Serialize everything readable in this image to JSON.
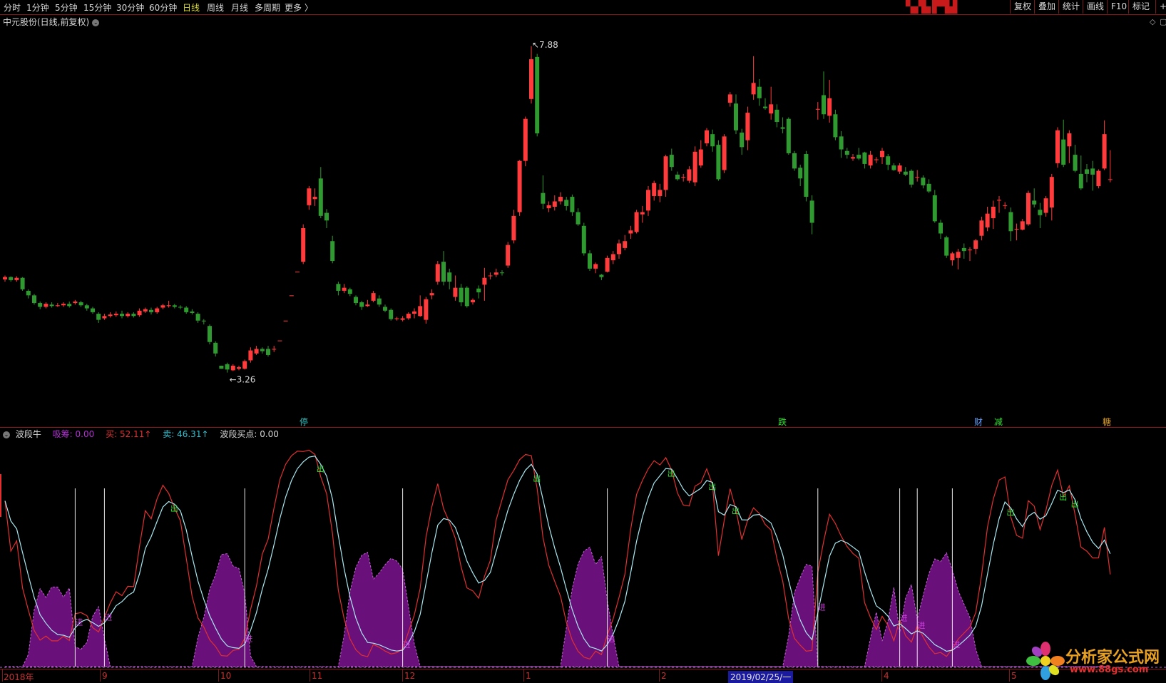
{
  "toolbar": {
    "periods": [
      "分时",
      "1分钟",
      "5分钟",
      "15分钟",
      "30分钟",
      "60分钟",
      "日线",
      "周线",
      "月线",
      "多周期",
      "更多 〉"
    ],
    "active_period": "日线",
    "tools": [
      "复权",
      "叠加",
      "统计",
      "画线",
      "F10",
      "标记",
      "+"
    ]
  },
  "stock": {
    "title": "中元股份(日线,前复权)",
    "high_label": "7.88",
    "low_label": "3.26"
  },
  "price_markers": [
    {
      "text": "停",
      "color": "#30c0c0"
    },
    {
      "text": "跌",
      "color": "#30e030"
    },
    {
      "text": "财",
      "color": "#60a0ff"
    },
    {
      "text": "减",
      "color": "#30e030"
    },
    {
      "text": "糖",
      "color": "#e0a020"
    }
  ],
  "indicator": {
    "name": "波段牛",
    "items": [
      {
        "label": "吸筹:",
        "value": "0.00",
        "color": "#b030d0"
      },
      {
        "label": "买:",
        "value": "52.11↑",
        "color": "#e03030"
      },
      {
        "label": "卖:",
        "value": "46.31↑",
        "color": "#30c0d0"
      },
      {
        "label": "波段买点:",
        "value": "0.00",
        "color": "#d8d8d8"
      }
    ],
    "signal_out": "出",
    "signal_in": "进"
  },
  "x_axis": [
    "2018年",
    "9",
    "10",
    "11",
    "12",
    "1",
    "2",
    "2019/02/25/一",
    "4",
    "5"
  ],
  "watermark": {
    "cn": "分析家公式网",
    "url": "www.88gs.com"
  },
  "colors": {
    "up": "#ff3b3b",
    "down": "#2f9a2f",
    "buy_line": "#e03030",
    "sell_line": "#a8e8f0",
    "accum": "#6a107a"
  },
  "chart_data": {
    "type": "candlestick",
    "title": "中元股份(日线,前复权)",
    "price_range": [
      3.0,
      8.0
    ],
    "max_price": 7.88,
    "min_price": 3.26,
    "candles": [
      [
        4.83,
        4.86,
        4.88,
        4.8
      ],
      [
        4.86,
        4.82,
        4.87,
        4.8
      ],
      [
        4.82,
        4.85,
        4.87,
        4.8
      ],
      [
        4.85,
        4.7,
        4.86,
        4.68
      ],
      [
        4.68,
        4.62,
        4.7,
        4.58
      ],
      [
        4.62,
        4.52,
        4.64,
        4.5
      ],
      [
        4.52,
        4.47,
        4.54,
        4.44
      ],
      [
        4.47,
        4.51,
        4.53,
        4.45
      ],
      [
        4.5,
        4.48,
        4.53,
        4.46
      ],
      [
        4.48,
        4.49,
        4.52,
        4.47
      ],
      [
        4.49,
        4.51,
        4.53,
        4.47
      ],
      [
        4.51,
        4.48,
        4.54,
        4.46
      ],
      [
        4.52,
        4.54,
        4.56,
        4.5
      ],
      [
        4.53,
        4.49,
        4.55,
        4.47
      ],
      [
        4.49,
        4.45,
        4.51,
        4.42
      ],
      [
        4.45,
        4.4,
        4.47,
        4.38
      ],
      [
        4.38,
        4.3,
        4.4,
        4.26
      ],
      [
        4.32,
        4.35,
        4.38,
        4.3
      ],
      [
        4.35,
        4.37,
        4.4,
        4.33
      ],
      [
        4.36,
        4.38,
        4.41,
        4.34
      ],
      [
        4.38,
        4.35,
        4.42,
        4.32
      ],
      [
        4.35,
        4.38,
        4.4,
        4.33
      ],
      [
        4.38,
        4.35,
        4.4,
        4.33
      ],
      [
        4.36,
        4.42,
        4.45,
        4.34
      ],
      [
        4.41,
        4.44,
        4.46,
        4.39
      ],
      [
        4.43,
        4.4,
        4.46,
        4.37
      ],
      [
        4.4,
        4.45,
        4.47,
        4.38
      ],
      [
        4.46,
        4.49,
        4.51,
        4.44
      ],
      [
        4.48,
        4.49,
        4.55,
        4.46
      ],
      [
        4.49,
        4.47,
        4.51,
        4.45
      ],
      [
        4.47,
        4.46,
        4.49,
        4.44
      ],
      [
        4.46,
        4.4,
        4.48,
        4.38
      ],
      [
        4.41,
        4.39,
        4.44,
        4.37
      ],
      [
        4.38,
        4.29,
        4.4,
        4.26
      ],
      [
        4.29,
        4.28,
        4.31,
        4.24
      ],
      [
        4.22,
        4.01,
        4.24,
        3.98
      ],
      [
        4.0,
        3.86,
        4.02,
        3.82
      ],
      [
        3.7,
        3.66,
        3.7,
        3.66
      ],
      [
        3.72,
        3.65,
        3.74,
        3.61
      ],
      [
        3.64,
        3.7,
        3.72,
        3.63
      ],
      [
        3.66,
        3.68,
        3.7,
        3.64
      ],
      [
        3.66,
        3.76,
        3.78,
        3.65
      ],
      [
        3.77,
        3.9,
        3.94,
        3.74
      ],
      [
        3.86,
        3.92,
        3.96,
        3.84
      ],
      [
        3.92,
        3.89,
        3.94,
        3.86
      ],
      [
        3.92,
        3.84,
        3.96,
        3.82
      ],
      [
        3.91,
        3.92,
        3.96,
        3.88
      ],
      [
        4.03,
        4.03,
        4.03,
        4.03
      ],
      [
        4.29,
        4.29,
        4.29,
        4.29
      ],
      [
        4.62,
        4.62,
        4.62,
        4.62
      ],
      [
        4.93,
        4.93,
        4.93,
        4.93
      ],
      [
        5.06,
        5.5,
        5.55,
        5.03
      ],
      [
        5.8,
        6.02,
        6.05,
        5.74
      ],
      [
        5.88,
        5.91,
        6.02,
        5.79
      ],
      [
        6.15,
        5.66,
        6.3,
        5.63
      ],
      [
        5.7,
        5.6,
        5.75,
        5.5
      ],
      [
        5.33,
        5.07,
        5.4,
        5.04
      ],
      [
        4.77,
        4.68,
        4.8,
        4.62
      ],
      [
        4.68,
        4.72,
        4.77,
        4.65
      ],
      [
        4.7,
        4.64,
        4.72,
        4.61
      ],
      [
        4.6,
        4.52,
        4.62,
        4.49
      ],
      [
        4.53,
        4.47,
        4.55,
        4.43
      ],
      [
        4.48,
        4.5,
        4.56,
        4.47
      ],
      [
        4.55,
        4.65,
        4.68,
        4.53
      ],
      [
        4.58,
        4.5,
        4.62,
        4.47
      ],
      [
        4.47,
        4.42,
        4.5,
        4.4
      ],
      [
        4.43,
        4.31,
        4.45,
        4.29
      ],
      [
        4.31,
        4.32,
        4.34,
        4.29
      ],
      [
        4.3,
        4.32,
        4.35,
        4.28
      ],
      [
        4.32,
        4.38,
        4.4,
        4.3
      ],
      [
        4.38,
        4.41,
        4.45,
        4.32
      ],
      [
        4.35,
        4.48,
        4.62,
        4.34
      ],
      [
        4.3,
        4.57,
        4.6,
        4.25
      ],
      [
        4.62,
        4.65,
        4.7,
        4.57
      ],
      [
        4.8,
        5.03,
        5.07,
        4.76
      ],
      [
        5.06,
        4.8,
        5.2,
        4.75
      ],
      [
        4.92,
        4.8,
        4.97,
        4.7
      ],
      [
        4.6,
        4.72,
        4.88,
        4.55
      ],
      [
        4.72,
        4.53,
        4.77,
        4.48
      ],
      [
        4.72,
        4.48,
        4.74,
        4.46
      ],
      [
        4.53,
        4.56,
        4.58,
        4.5
      ],
      [
        4.71,
        4.66,
        4.75,
        4.58
      ],
      [
        4.76,
        4.85,
        4.98,
        4.55
      ],
      [
        4.88,
        4.88,
        4.92,
        4.83
      ],
      [
        4.89,
        4.92,
        4.97,
        4.86
      ],
      [
        4.92,
        4.91,
        4.95,
        4.88
      ],
      [
        5.01,
        5.28,
        5.32,
        4.98
      ],
      [
        5.34,
        5.66,
        5.74,
        5.3
      ],
      [
        5.71,
        6.38,
        6.39,
        5.66
      ],
      [
        6.38,
        6.93,
        6.96,
        6.31
      ],
      [
        7.19,
        7.71,
        7.88,
        7.13
      ],
      [
        7.74,
        6.74,
        7.78,
        6.7
      ],
      [
        5.96,
        5.82,
        6.19,
        5.75
      ],
      [
        5.76,
        5.8,
        5.85,
        5.71
      ],
      [
        5.78,
        5.85,
        5.93,
        5.73
      ],
      [
        5.85,
        5.91,
        5.97,
        5.81
      ],
      [
        5.87,
        5.79,
        5.91,
        5.73
      ],
      [
        5.91,
        5.71,
        5.94,
        5.66
      ],
      [
        5.71,
        5.55,
        5.76,
        5.53
      ],
      [
        5.53,
        5.17,
        5.57,
        5.14
      ],
      [
        5.17,
        4.97,
        5.21,
        4.94
      ],
      [
        4.97,
        5.03,
        5.05,
        4.91
      ],
      [
        4.89,
        4.86,
        4.9,
        4.82
      ],
      [
        4.93,
        5.11,
        5.14,
        4.92
      ],
      [
        5.08,
        5.16,
        5.2,
        5.03
      ],
      [
        5.16,
        5.3,
        5.35,
        5.1
      ],
      [
        5.24,
        5.33,
        5.41,
        5.21
      ],
      [
        5.43,
        5.47,
        5.53,
        5.36
      ],
      [
        5.45,
        5.71,
        5.74,
        5.43
      ],
      [
        5.68,
        5.71,
        5.79,
        5.57
      ],
      [
        5.73,
        6.0,
        6.05,
        5.66
      ],
      [
        5.92,
        6.09,
        6.12,
        5.86
      ],
      [
        5.92,
        6.0,
        6.08,
        5.84
      ],
      [
        6.0,
        6.44,
        6.46,
        5.91
      ],
      [
        6.46,
        6.3,
        6.54,
        6.25
      ],
      [
        6.2,
        6.14,
        6.24,
        6.12
      ],
      [
        6.16,
        6.17,
        6.21,
        6.11
      ],
      [
        6.12,
        6.27,
        6.31,
        6.09
      ],
      [
        6.1,
        6.5,
        6.57,
        6.05
      ],
      [
        6.32,
        6.53,
        6.65,
        6.29
      ],
      [
        6.61,
        6.78,
        6.81,
        6.57
      ],
      [
        6.73,
        6.57,
        6.79,
        6.5
      ],
      [
        6.59,
        6.14,
        6.65,
        6.12
      ],
      [
        6.26,
        6.7,
        6.73,
        6.22
      ],
      [
        7.14,
        7.25,
        7.28,
        7.09
      ],
      [
        7.13,
        6.78,
        7.25,
        6.73
      ],
      [
        6.75,
        6.56,
        6.8,
        6.46
      ],
      [
        6.65,
        7.01,
        7.09,
        6.52
      ],
      [
        7.25,
        7.4,
        7.75,
        7.18
      ],
      [
        7.35,
        7.2,
        7.45,
        7.1
      ],
      [
        7.09,
        7.07,
        7.2,
        7.05
      ],
      [
        7.0,
        7.12,
        7.35,
        6.92
      ],
      [
        7.05,
        6.89,
        7.12,
        6.82
      ],
      [
        6.82,
        6.8,
        6.95,
        6.74
      ],
      [
        6.93,
        6.48,
        6.95,
        6.46
      ],
      [
        6.48,
        6.28,
        6.51,
        6.25
      ],
      [
        6.29,
        6.15,
        6.33,
        6.05
      ],
      [
        6.47,
        5.91,
        6.51,
        5.85
      ],
      [
        5.86,
        5.57,
        5.93,
        5.42
      ],
      [
        7.05,
        7.06,
        7.15,
        6.92
      ],
      [
        7.24,
        6.99,
        7.55,
        6.93
      ],
      [
        6.97,
        7.2,
        7.44,
        6.88
      ],
      [
        6.99,
        6.69,
        7.05,
        6.65
      ],
      [
        6.7,
        6.53,
        6.77,
        6.42
      ],
      [
        6.51,
        6.46,
        6.55,
        6.41
      ],
      [
        6.41,
        6.43,
        6.47,
        6.38
      ],
      [
        6.46,
        6.41,
        6.55,
        6.39
      ],
      [
        6.49,
        6.34,
        6.5,
        6.28
      ],
      [
        6.32,
        6.46,
        6.51,
        6.28
      ],
      [
        6.39,
        6.4,
        6.43,
        6.35
      ],
      [
        6.43,
        6.51,
        6.55,
        6.34
      ],
      [
        6.44,
        6.33,
        6.47,
        6.26
      ],
      [
        6.32,
        6.26,
        6.35,
        6.25
      ],
      [
        6.24,
        6.32,
        6.35,
        6.21
      ],
      [
        6.24,
        6.2,
        6.3,
        6.18
      ],
      [
        6.25,
        6.07,
        6.27,
        6.03
      ],
      [
        6.17,
        6.17,
        6.26,
        6.11
      ],
      [
        6.16,
        6.06,
        6.19,
        6.02
      ],
      [
        6.08,
        5.98,
        6.14,
        5.96
      ],
      [
        5.93,
        5.59,
        6.0,
        5.57
      ],
      [
        5.57,
        5.43,
        5.61,
        5.36
      ],
      [
        5.38,
        5.14,
        5.4,
        5.11
      ],
      [
        5.08,
        5.17,
        5.19,
        5.01
      ],
      [
        5.11,
        5.19,
        5.23,
        4.96
      ],
      [
        5.24,
        5.2,
        5.3,
        5.1
      ],
      [
        5.21,
        5.22,
        5.25,
        5.07
      ],
      [
        5.23,
        5.34,
        5.36,
        5.16
      ],
      [
        5.4,
        5.6,
        5.65,
        5.34
      ],
      [
        5.51,
        5.69,
        5.78,
        5.46
      ],
      [
        5.63,
        5.78,
        5.86,
        5.49
      ],
      [
        5.86,
        5.87,
        5.92,
        5.7
      ],
      [
        5.8,
        5.8,
        5.84,
        5.75
      ],
      [
        5.71,
        5.46,
        5.77,
        5.33
      ],
      [
        5.48,
        5.49,
        5.56,
        5.34
      ],
      [
        5.48,
        5.59,
        5.62,
        5.47
      ],
      [
        5.55,
        5.96,
        5.99,
        5.53
      ],
      [
        5.86,
        5.81,
        6.02,
        5.77
      ],
      [
        5.74,
        5.67,
        5.83,
        5.5
      ],
      [
        5.7,
        5.89,
        5.92,
        5.65
      ],
      [
        5.77,
        6.17,
        6.21,
        5.6
      ],
      [
        6.35,
        6.78,
        6.82,
        6.29
      ],
      [
        6.66,
        6.33,
        6.92,
        6.3
      ],
      [
        6.57,
        6.74,
        6.78,
        6.35
      ],
      [
        6.46,
        6.25,
        6.59,
        6.23
      ],
      [
        6.21,
        6.02,
        6.45,
        6.0
      ],
      [
        6.27,
        6.21,
        6.34,
        6.1
      ],
      [
        6.28,
        6.2,
        6.38,
        5.99
      ],
      [
        6.05,
        6.25,
        6.27,
        6.02
      ],
      [
        6.28,
        6.73,
        6.91,
        6.26
      ],
      [
        6.14,
        6.14,
        6.52,
        6.1
      ]
    ],
    "indicator_series": [
      {
        "name": "买",
        "range": [
          0,
          100
        ]
      },
      {
        "name": "卖",
        "range": [
          0,
          100
        ]
      },
      {
        "name": "吸筹",
        "range": [
          0,
          100
        ]
      }
    ]
  }
}
